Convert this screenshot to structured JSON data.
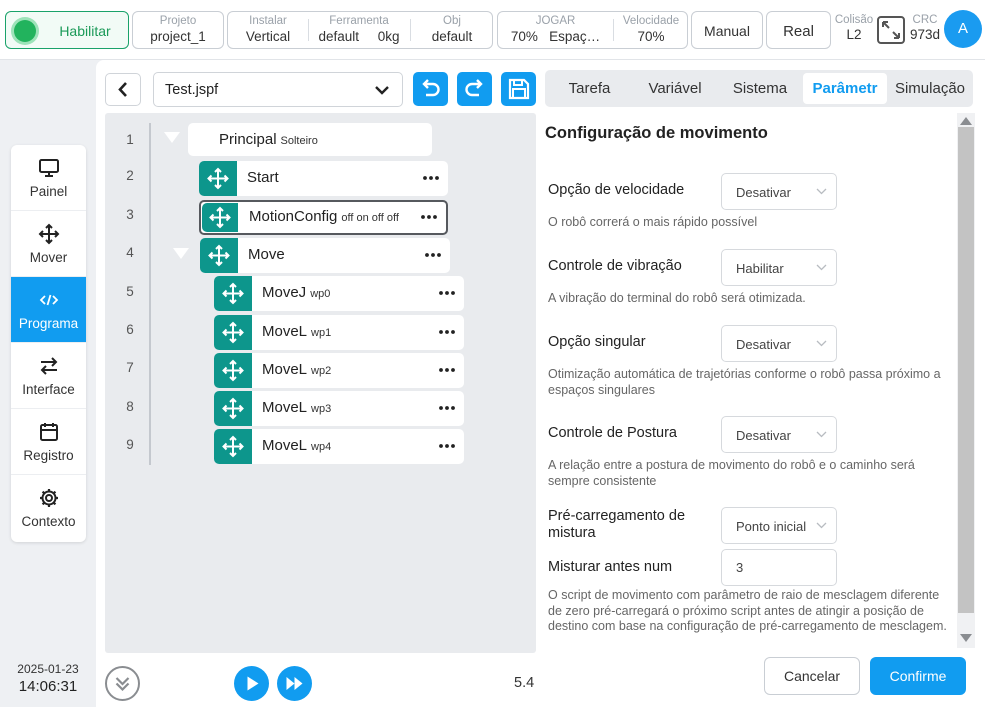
{
  "topbar": {
    "enable_label": "Habilitar",
    "project": {
      "caption": "Projeto",
      "value": "project_1"
    },
    "install": {
      "caption": "Instalar",
      "value": "Vertical"
    },
    "tool": {
      "caption": "Ferramenta",
      "value": "default",
      "weight": "0kg"
    },
    "obj": {
      "caption": "Obj",
      "value": "default"
    },
    "jog": {
      "caption": "JOGAR",
      "value": "70%",
      "space": "Espaç…"
    },
    "speed": {
      "caption": "Velocidade",
      "value": "70%"
    },
    "manual_label": "Manual",
    "real_label": "Real",
    "collision": {
      "caption": "Colisão",
      "value": "L2"
    },
    "crc": {
      "caption": "CRC",
      "value": "973d"
    },
    "avatar_letter": "A"
  },
  "nav": {
    "items": [
      {
        "label": "Painel",
        "icon": "monitor-icon"
      },
      {
        "label": "Mover",
        "icon": "move-icon"
      },
      {
        "label": "Programa",
        "icon": "code-icon"
      },
      {
        "label": "Interface",
        "icon": "swap-icon"
      },
      {
        "label": "Registro",
        "icon": "calendar-icon"
      },
      {
        "label": "Contexto",
        "icon": "gear-icon"
      }
    ],
    "active": "Programa"
  },
  "datetime": {
    "date": "2025-01-23",
    "time": "14:06:31"
  },
  "program": {
    "file_name": "Test.jspf",
    "line_numbers": [
      "1",
      "2",
      "3",
      "4",
      "5",
      "6",
      "7",
      "8",
      "9"
    ],
    "root": {
      "name": "Principal",
      "sub": "Solteiro"
    },
    "nodes": [
      {
        "name": "Start",
        "sub": ""
      },
      {
        "name": "MotionConfig",
        "sub": "off on off off"
      },
      {
        "name": "Move",
        "sub": ""
      },
      {
        "name": "MoveJ",
        "sub": "wp0"
      },
      {
        "name": "MoveL",
        "sub": "wp1"
      },
      {
        "name": "MoveL",
        "sub": "wp2"
      },
      {
        "name": "MoveL",
        "sub": "wp3"
      },
      {
        "name": "MoveL",
        "sub": "wp4"
      }
    ],
    "speed_value": "5.4"
  },
  "tabs": [
    "Tarefa",
    "Variável",
    "Sistema",
    "Parâmetr",
    "Simulação"
  ],
  "active_tab": "Parâmetr",
  "config": {
    "title": "Configuração de movimento",
    "velocity": {
      "label": "Opção de velocidade",
      "value": "Desativar",
      "desc": "O robô correrá o mais rápido possível"
    },
    "vibration": {
      "label": "Controle de vibração",
      "value": "Habilitar",
      "desc": "A vibração do terminal do robô será otimizada."
    },
    "singular": {
      "label": "Opção singular",
      "value": "Desativar",
      "desc": "Otimização automática de trajetórias conforme o robô passa próximo a espaços singulares"
    },
    "posture": {
      "label": "Controle de Postura",
      "value": "Desativar",
      "desc": "A relação entre a postura de movimento do robô e o caminho será sempre consistente"
    },
    "preload": {
      "label": "Pré-carregamento de mistura",
      "value": "Ponto inicial"
    },
    "blend_before": {
      "label": "Misturar antes num",
      "value": "3",
      "desc": "O script de movimento com parâmetro de raio de mesclagem diferente de zero pré-carregará o próximo script antes de atingir a posição de destino com base na configuração de pré-carregamento de mesclagem."
    }
  },
  "actions": {
    "cancel": "Cancelar",
    "confirm": "Confirme"
  },
  "colors": {
    "accent": "#119cf0",
    "node_icon": "#0d968c",
    "enabled": "#22b35d"
  }
}
